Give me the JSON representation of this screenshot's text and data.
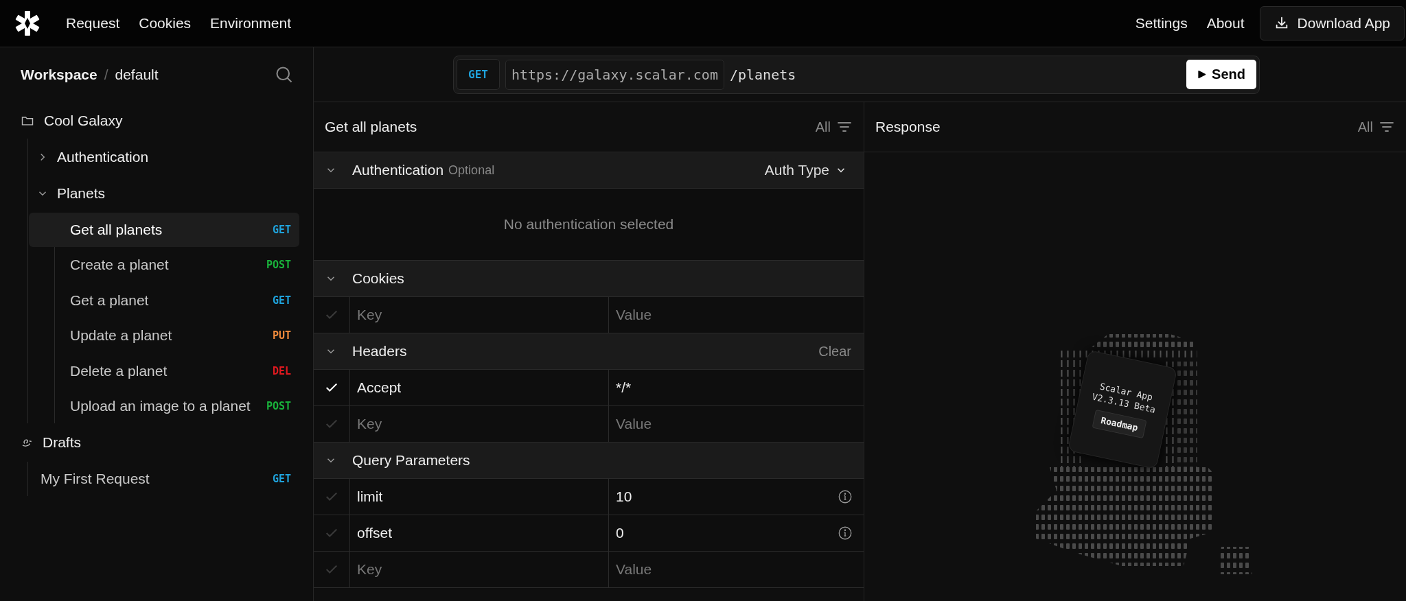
{
  "topbar": {
    "nav": [
      "Request",
      "Cookies",
      "Environment"
    ],
    "links": [
      "Settings",
      "About"
    ],
    "download": "Download App"
  },
  "sidebar": {
    "workspace": "Workspace",
    "separator": "/",
    "name": "default",
    "tree": [
      {
        "label": "Cool Galaxy",
        "kind": "collection",
        "children": [
          {
            "label": "Authentication",
            "kind": "folder",
            "expanded": false
          },
          {
            "label": "Planets",
            "kind": "folder",
            "expanded": true,
            "children": [
              {
                "label": "Get all planets",
                "kind": "request",
                "method": "GET",
                "color": "#1fa3dc",
                "selected": true
              },
              {
                "label": "Create a planet",
                "kind": "request",
                "method": "POST",
                "color": "#19b23b",
                "selected": false
              },
              {
                "label": "Get a planet",
                "kind": "request",
                "method": "GET",
                "color": "#1fa3dc",
                "selected": false
              },
              {
                "label": "Update a planet",
                "kind": "request",
                "method": "PUT",
                "color": "#f08a3c",
                "selected": false
              },
              {
                "label": "Delete a planet",
                "kind": "request",
                "method": "DEL",
                "color": "#e0191f",
                "selected": false
              },
              {
                "label": "Upload an image to a planet",
                "kind": "request",
                "method": "POST",
                "color": "#19b23b",
                "selected": false
              }
            ]
          }
        ]
      },
      {
        "label": "Drafts",
        "kind": "drafts",
        "children": [
          {
            "label": "My First Request",
            "kind": "request",
            "method": "GET",
            "color": "#1fa3dc",
            "selected": false
          }
        ]
      }
    ]
  },
  "address": {
    "method": "GET",
    "base": "https://galaxy.scalar.com",
    "path": "/planets",
    "send": "Send"
  },
  "request": {
    "title": "Get all planets",
    "filter": "All",
    "auth": {
      "title": "Authentication",
      "hint": "Optional",
      "auth_type": "Auth Type",
      "empty": "No authentication selected"
    },
    "sections": [
      {
        "title": "Cookies",
        "rows": [
          {
            "key_placeholder": "Key",
            "value_placeholder": "Value",
            "checked": false,
            "info": false
          }
        ]
      },
      {
        "title": "Headers",
        "action": "Clear",
        "rows": [
          {
            "key": "Accept",
            "value": "*/*",
            "checked": true,
            "info": false
          },
          {
            "key_placeholder": "Key",
            "value_placeholder": "Value",
            "checked": false,
            "info": false
          }
        ]
      },
      {
        "title": "Query Parameters",
        "rows": [
          {
            "key": "limit",
            "value": "10",
            "checked": false,
            "info": true
          },
          {
            "key": "offset",
            "value": "0",
            "checked": false,
            "info": true
          },
          {
            "key_placeholder": "Key",
            "value_placeholder": "Value",
            "checked": false,
            "info": false
          }
        ]
      }
    ]
  },
  "response": {
    "title": "Response",
    "filter": "All",
    "banner": {
      "lines": [
        "Scalar App",
        "V2.3.13 Beta"
      ],
      "button": "Roadmap"
    }
  }
}
